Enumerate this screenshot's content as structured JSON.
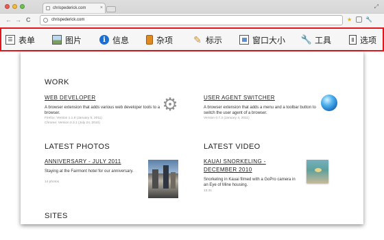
{
  "browser": {
    "tab_title": "chrispederick.com",
    "tab_close": "×",
    "url": "chrispederick.com",
    "back_glyph": "←",
    "forward_glyph": "→",
    "reload_glyph": "C",
    "resize_glyph": "⤢",
    "star_glyph": "★",
    "wrench_glyph": "🔧",
    "icons": [
      "back-icon",
      "forward-icon",
      "reload-icon",
      "globe-icon",
      "star-icon",
      "extension-icon",
      "wrench-icon"
    ]
  },
  "toolbar": {
    "border_color": "#e0161b",
    "items": [
      {
        "label": "表单",
        "icon": "form-icon",
        "glyph": "☰"
      },
      {
        "label": "图片",
        "icon": "image-icon",
        "glyph": ""
      },
      {
        "label": "信息",
        "icon": "info-icon",
        "glyph": "i"
      },
      {
        "label": "杂项",
        "icon": "misc-icon",
        "glyph": ""
      },
      {
        "label": "标示",
        "icon": "outline-pencil-icon",
        "glyph": "✎"
      },
      {
        "label": "窗口大小",
        "icon": "resize-icon",
        "glyph": ""
      },
      {
        "label": "工具",
        "icon": "tools-wrench-icon",
        "glyph": "🔧"
      },
      {
        "label": "选项",
        "icon": "options-icon",
        "glyph": "Ⅱ"
      }
    ]
  },
  "page": {
    "work": {
      "heading": "WORK",
      "items": [
        {
          "title": "WEB DEVELOPER",
          "description": "A browser extension that adds various web developer tools to a browser.",
          "meta": [
            "Firefox: Version 1.1.9 (January 5, 2011)",
            "Chrome: Version 0.3.1 (July 24, 2010)"
          ],
          "icon": "gear-icon",
          "glyph": "⚙"
        },
        {
          "title": "USER AGENT SWITCHER",
          "description": "A browser extension that adds a menu and a toolbar button to switch the user agent of a browser.",
          "meta": [
            "Version 0.7.3 (January 4, 2011)"
          ],
          "icon": "globe-sphere-icon"
        }
      ]
    },
    "photos": {
      "heading": "LATEST PHOTOS",
      "title": "ANNIVERSARY - JULY 2011",
      "description": "Staying at the Fairmont hotel for our anniversary.",
      "meta": "14 photos"
    },
    "video": {
      "heading": "LATEST VIDEO",
      "title_line1": "KAUAI SNORKELING -",
      "title_line2": "DECEMBER 2010",
      "description": "Snorkeling in Kauai filmed with a GoPro camera in an Eye of Mine housing.",
      "meta": "13:31"
    },
    "sites": {
      "heading": "SITES"
    }
  }
}
